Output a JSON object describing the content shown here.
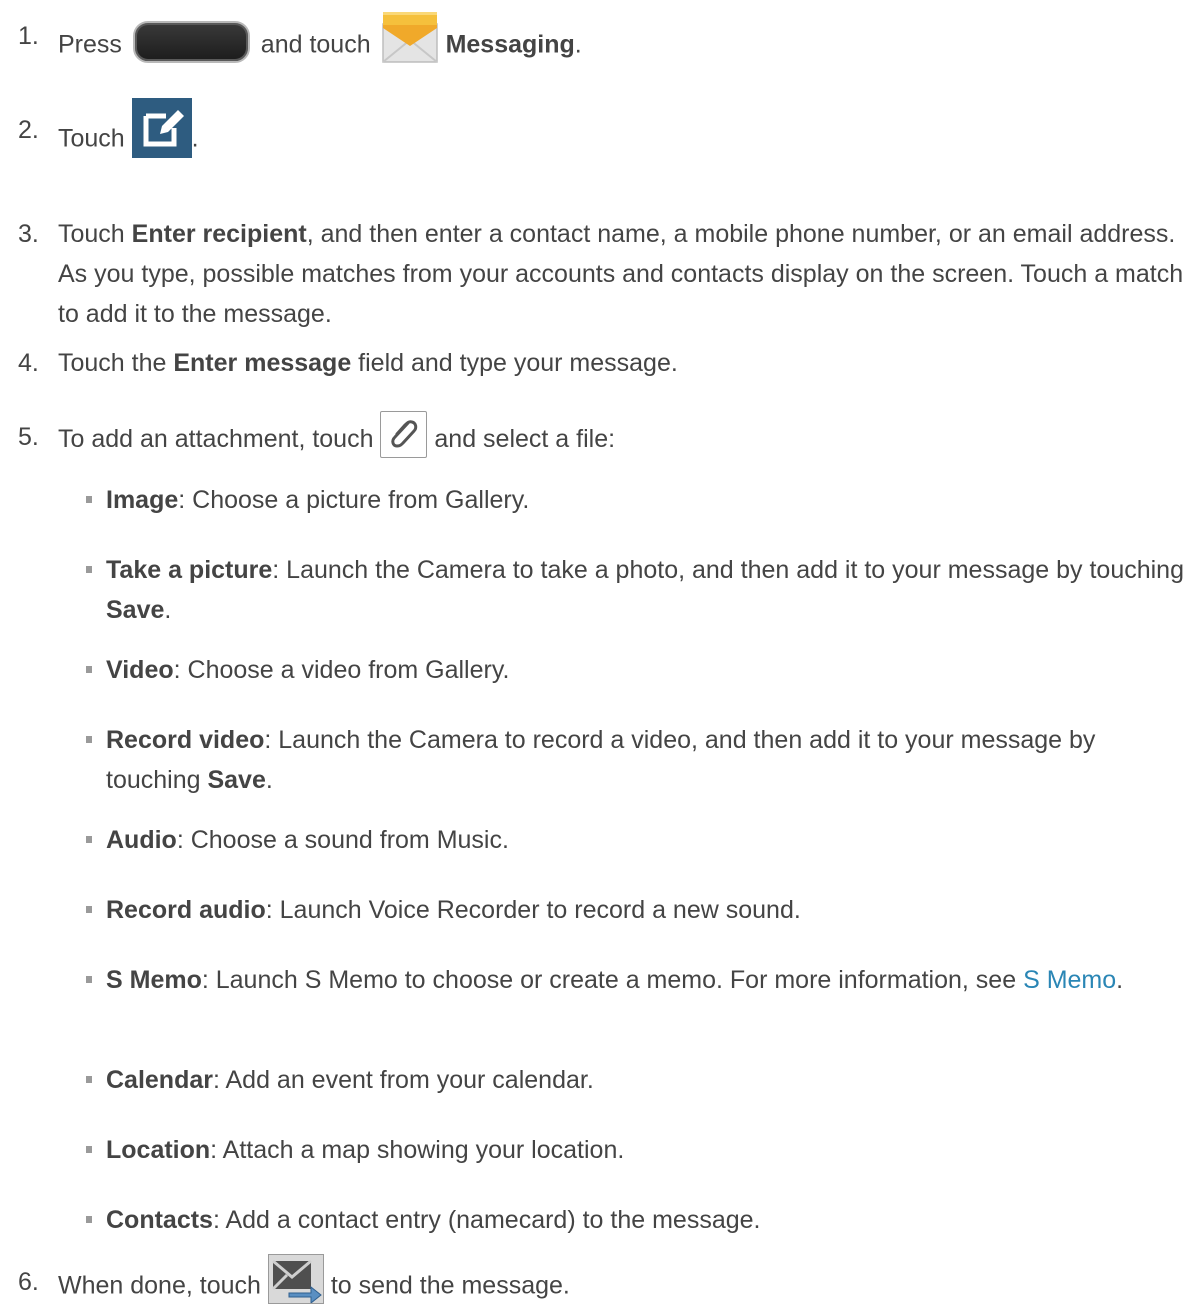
{
  "steps": [
    {
      "num": "1.",
      "t1": "Press ",
      "t2": " and touch ",
      "b1": "Messaging",
      "t3": "."
    },
    {
      "num": "2.",
      "t1": "Touch ",
      "t2": "."
    },
    {
      "num": "3.",
      "t1": "Touch ",
      "b1": "Enter recipient",
      "t2": ", and then enter a contact name, a mobile phone number, or an email address. As you type, possible matches from your accounts and contacts display on the screen. Touch a match to add it to the message."
    },
    {
      "num": "4.",
      "t1": "Touch the ",
      "b1": "Enter message",
      "t2": " field and type your message."
    },
    {
      "num": "5.",
      "t1": "To add an attachment, touch ",
      "t2": " and select a file:"
    },
    {
      "num": "6.",
      "t1": "When done, touch ",
      "t2": " to send the message."
    }
  ],
  "attachments": [
    {
      "label": "Image",
      "text": ": Choose a picture from Gallery."
    },
    {
      "label": "Take a picture",
      "text": ": Launch the Camera to take a photo, and then add it to your message by touching ",
      "bold_end": "Save",
      "end": "."
    },
    {
      "label": "Video",
      "text": ": Choose a video from Gallery."
    },
    {
      "label": "Record video",
      "text": ": Launch the Camera to record a video, and then add it to your message by touching ",
      "bold_end": "Save",
      "end": "."
    },
    {
      "label": "Audio",
      "text": ": Choose a sound from Music."
    },
    {
      "label": "Record audio",
      "text": ": Launch Voice Recorder to record a new sound."
    },
    {
      "label": "S Memo",
      "text": ": Launch S Memo to choose or create a memo. For more information, see ",
      "link": "S Memo",
      "end": "."
    },
    {
      "label": "Calendar",
      "text": ": Add an event from your calendar."
    },
    {
      "label": "Location",
      "text": ": Attach a map showing your location."
    },
    {
      "label": "Contacts",
      "text": ": Add a contact entry (namecard) to the message."
    }
  ],
  "icons": {
    "home_key": "home-key-icon",
    "messaging": "messaging-icon",
    "compose": "compose-icon",
    "attach": "paperclip-icon",
    "send": "send-icon"
  },
  "colors": {
    "text": "#444444",
    "link": "#2a86b5",
    "compose_bg": "#2e5c80",
    "envelope_flap": "#f0a92a"
  }
}
